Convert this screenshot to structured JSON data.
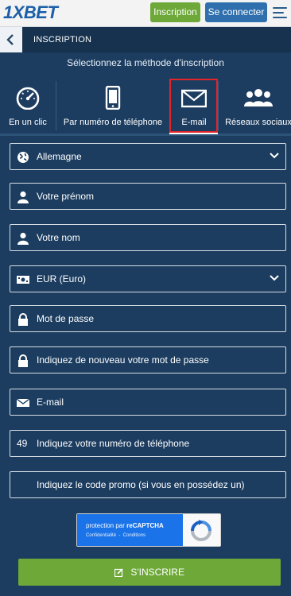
{
  "header": {
    "logo": "1XBET",
    "inscription_label": "Inscription",
    "connect_label": "Se connecter",
    "menu_icon": "hamburger-icon"
  },
  "subheader": {
    "back_icon": "chevron-left-icon",
    "title": "INSCRIPTION"
  },
  "method": {
    "heading": "Sélectionnez la méthode d'inscription",
    "tabs": [
      {
        "label": "En un clic",
        "icon": "speedometer-icon"
      },
      {
        "label": "Par numéro de téléphone",
        "icon": "smartphone-icon"
      },
      {
        "label": "E-mail",
        "icon": "envelope-icon",
        "selected": true
      },
      {
        "label": "Réseaux sociaux",
        "icon": "users-icon"
      }
    ]
  },
  "form": {
    "country": "Allemagne",
    "first_name_placeholder": "Votre prénom",
    "last_name_placeholder": "Votre nom",
    "currency": "EUR (Euro)",
    "password_placeholder": "Mot de passe",
    "password_repeat_placeholder": "Indiquez de nouveau votre mot de passe",
    "email_placeholder": "E-mail",
    "phone_prefix": "49",
    "phone_placeholder": "Indiquez votre numéro de téléphone",
    "promo_placeholder": "Indiquez le code promo (si vous en possédez un)"
  },
  "captcha": {
    "title_prefix": "protection par",
    "title_brand": "reCAPTCHA",
    "privacy": "Confidentialité",
    "terms": "Conditions"
  },
  "submit_label": "S'INSCRIRE",
  "colors": {
    "background": "#1c3d60",
    "accent_green": "#6da838",
    "accent_blue": "#2f6fad",
    "selected_border": "#e0252b"
  }
}
